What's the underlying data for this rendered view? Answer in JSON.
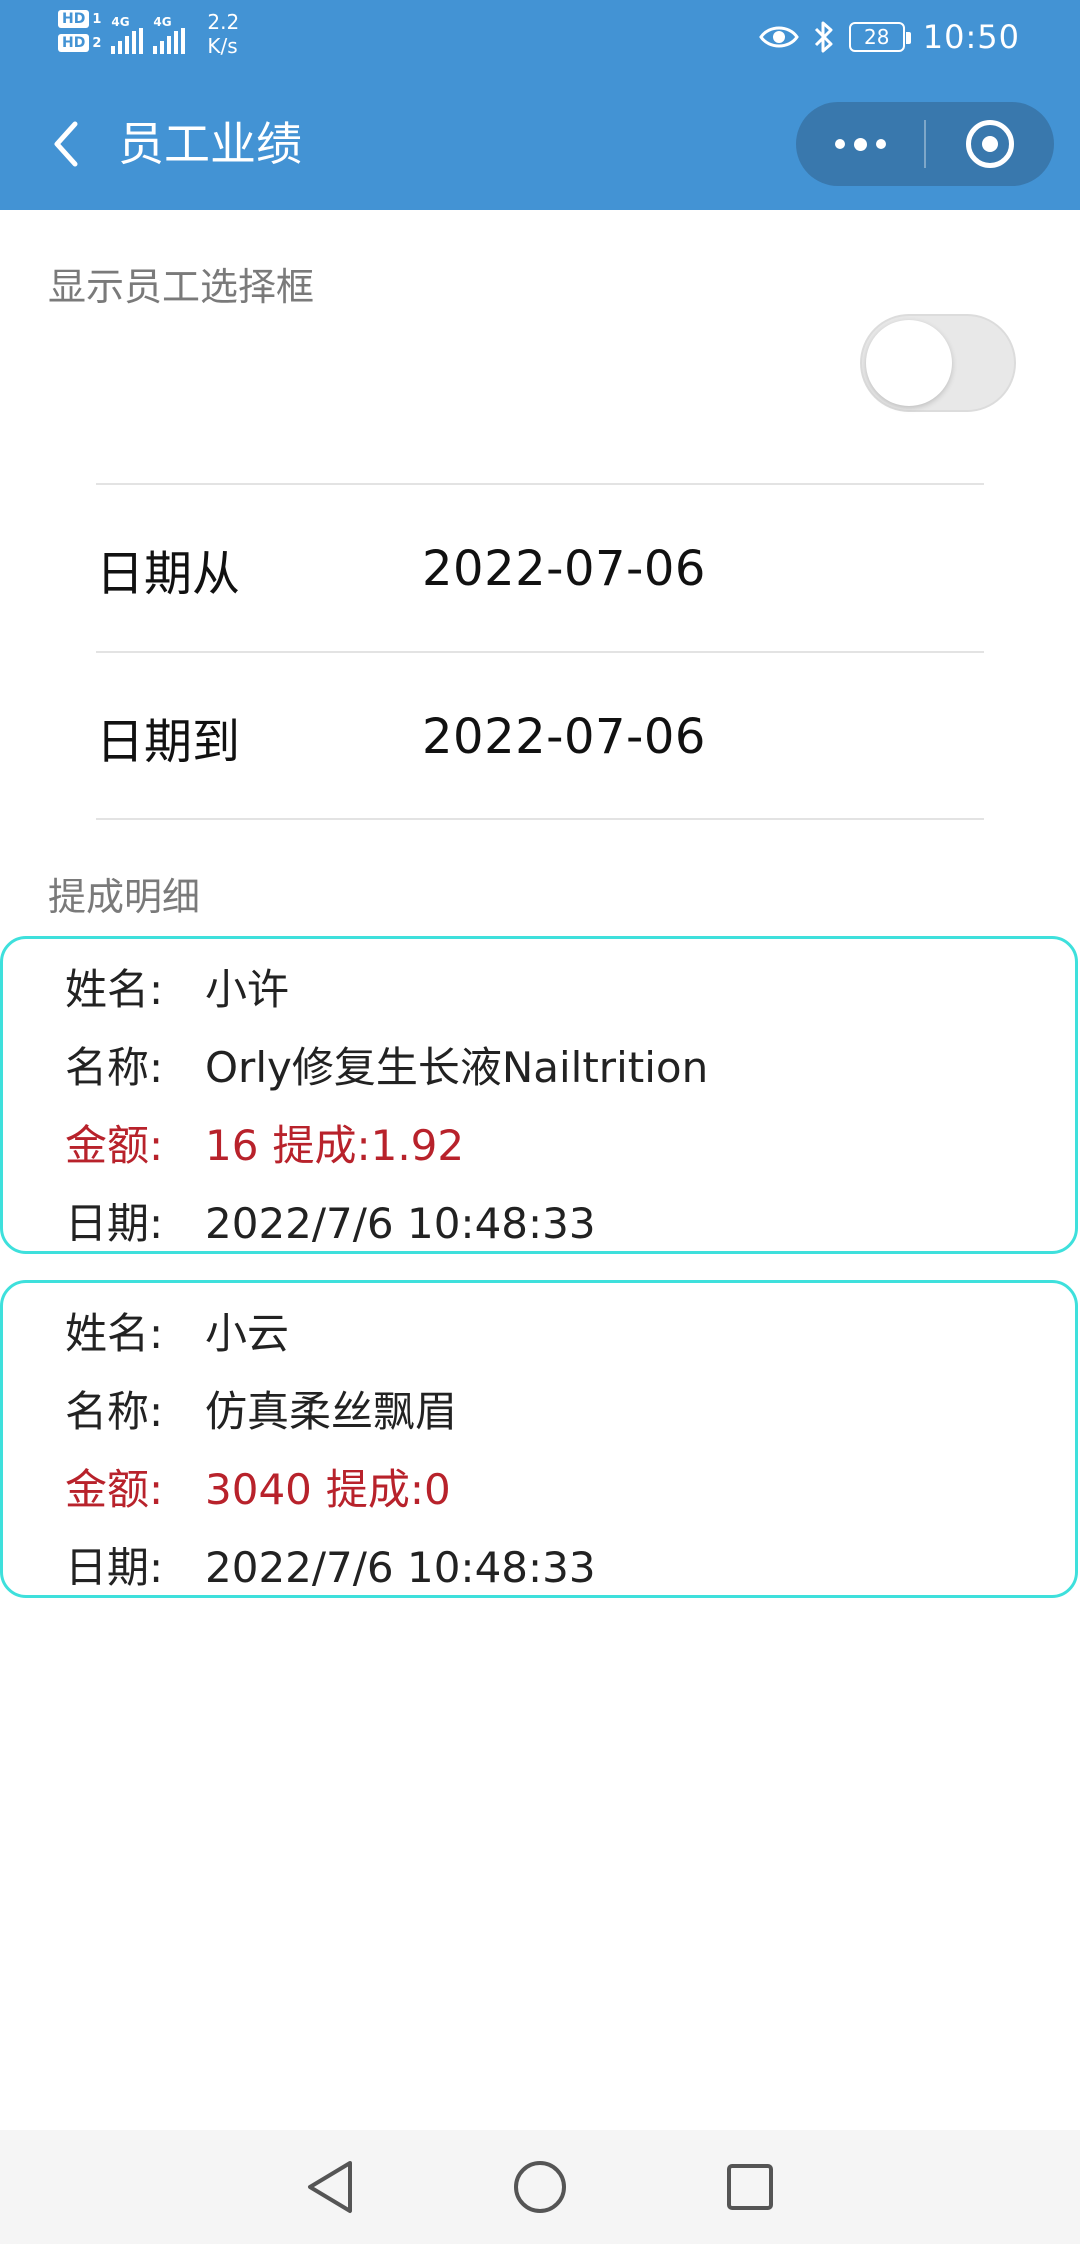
{
  "status_bar": {
    "hd1": "HD",
    "hd1_num": "1",
    "hd2": "HD",
    "hd2_num": "2",
    "net1": "4G",
    "net2": "4G",
    "speed_value": "2.2",
    "speed_unit": "K/s",
    "battery": "28",
    "time": "10:50"
  },
  "nav": {
    "title": "员工业绩"
  },
  "filter": {
    "show_selector_label": "显示员工选择框",
    "show_selector_on": false,
    "date_from_label": "日期从",
    "date_from_value": "2022-07-06",
    "date_to_label": "日期到",
    "date_to_value": "2022-07-06"
  },
  "detail": {
    "section_title": "提成明细",
    "records": [
      {
        "name_key": "姓名:",
        "name": "小许",
        "product_key": "名称:",
        "product": "Orly修复生长液Nailtrition",
        "amount_key": "金额:",
        "amount": "16",
        "commission_key": "提成:",
        "commission": "1.92",
        "date_key": "日期:",
        "date": "2022/7/6 10:48:33"
      },
      {
        "name_key": "姓名:",
        "name": "小云",
        "product_key": "名称:",
        "product": "仿真柔丝飘眉",
        "amount_key": "金额:",
        "amount": "3040",
        "commission_key": "提成:",
        "commission": "0",
        "date_key": "日期:",
        "date": "2022/7/6 10:48:33"
      }
    ]
  },
  "colors": {
    "brand": "#4393d4",
    "card_border": "#3ee0dc",
    "money": "#b8222b"
  }
}
